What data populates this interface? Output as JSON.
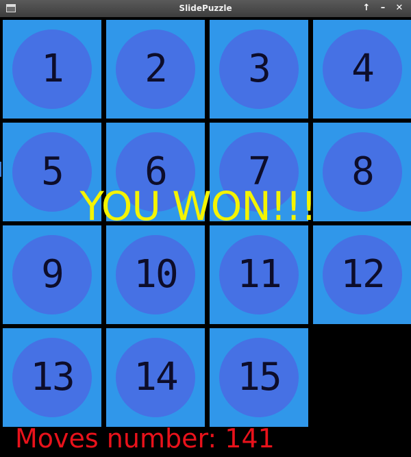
{
  "window": {
    "title": "SlidePuzzle",
    "buttons": {
      "maximize": "🡑",
      "minimize": "–",
      "close": "✕"
    }
  },
  "board": {
    "tiles": [
      "1",
      "2",
      "3",
      "4",
      "5",
      "6",
      "7",
      "8",
      "9",
      "10",
      "11",
      "12",
      "13",
      "14",
      "15"
    ],
    "empty_slot": "16"
  },
  "message": "YOU WON!!!",
  "status": {
    "moves_text": "Moves number: 141"
  },
  "colors": {
    "tile": "#3097ea",
    "circle": "#4671e4",
    "number": "#0d0d2a",
    "win_text": "#f4f400",
    "moves_text": "#e8121b",
    "background": "#000000"
  }
}
